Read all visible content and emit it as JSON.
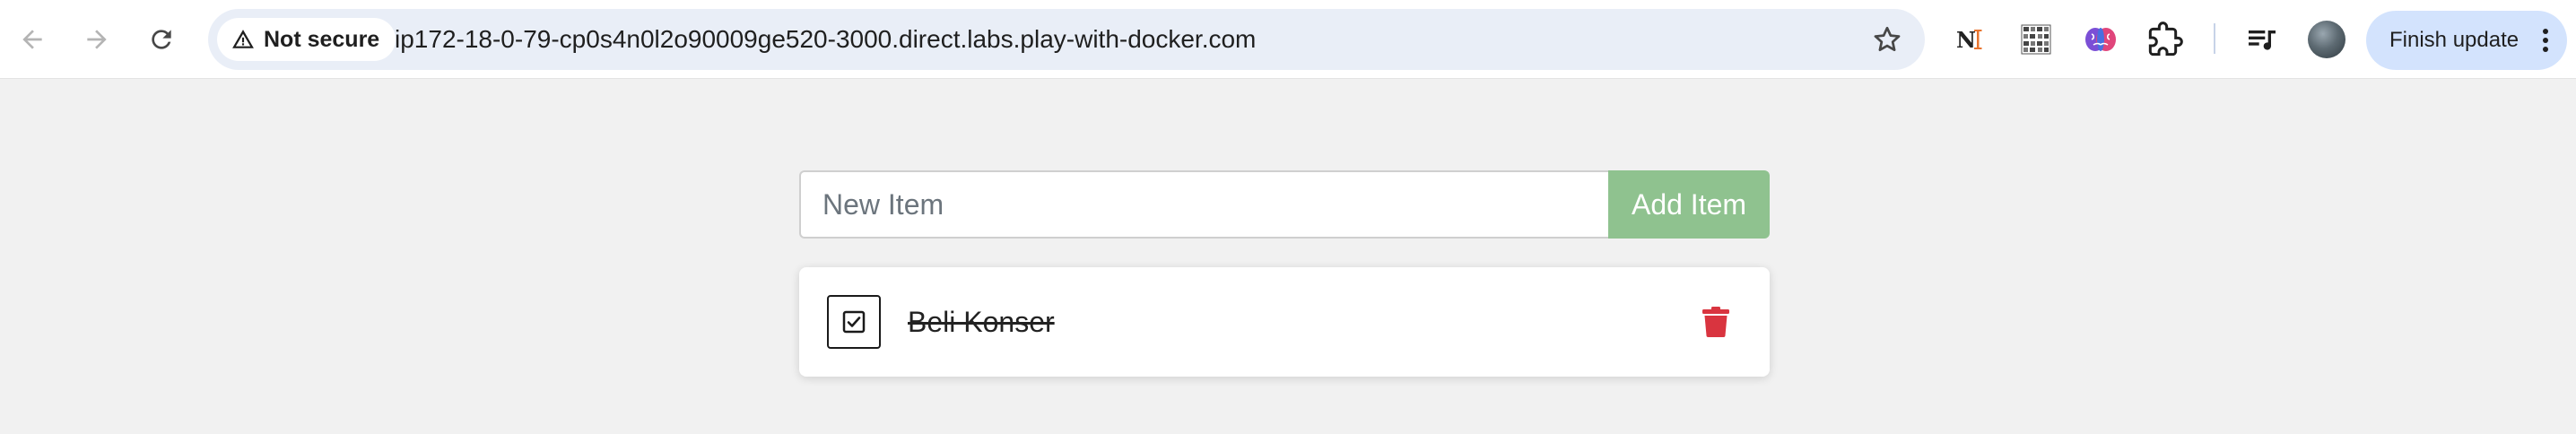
{
  "browser": {
    "security_label": "Not secure",
    "url": "ip172-18-0-79-cp0s4n0l2o90009ge520-3000.direct.labs.play-with-docker.com",
    "finish_update_label": "Finish update",
    "icons": [
      "back-icon",
      "forward-icon",
      "reload-icon",
      "warning-icon",
      "star-icon",
      "extension-n-icon",
      "extension-qr-icon",
      "extension-brain-icon",
      "extensions-puzzle-icon",
      "media-queue-icon",
      "avatar",
      "more-vert-icon"
    ]
  },
  "todo": {
    "input_placeholder": "New Item",
    "input_value": "",
    "add_button_label": "Add Item",
    "items": [
      {
        "name": "Beli Konser",
        "completed": true
      }
    ]
  },
  "colors": {
    "add_button": "#8fc28f",
    "trash": "#d9343f",
    "page_background": "#f1f1f1",
    "finish_update_bg": "#d3e3fd"
  }
}
